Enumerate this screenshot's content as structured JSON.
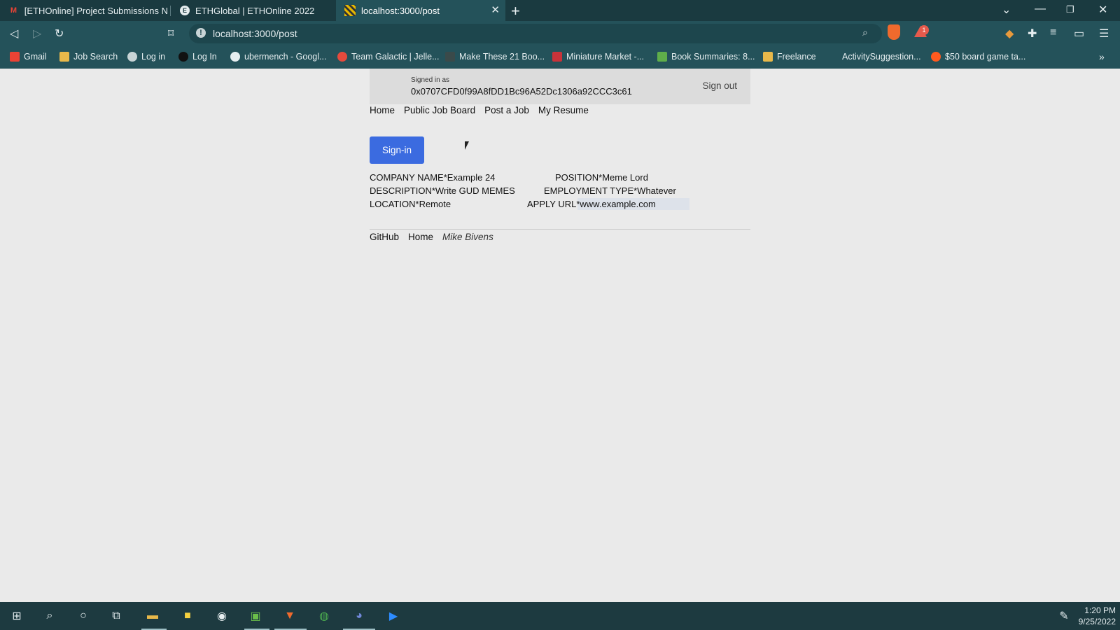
{
  "browser": {
    "tabs": [
      {
        "title": "[ETHOnline] Project Submissions Now",
        "favicon": "gmail-icon"
      },
      {
        "title": "ETHGlobal | ETHOnline 2022",
        "favicon": "ethglobal-icon"
      },
      {
        "title": "localhost:3000/post",
        "favicon": "page-icon",
        "active": true
      }
    ],
    "url": "localhost:3000/post",
    "rewards_badge": "1",
    "bookmarks": [
      "Gmail",
      "Job Search",
      "Log in",
      "Log In",
      "ubermench - Googl...",
      "Team Galactic | Jelle...",
      "Make These 21 Boo...",
      "Miniature Market -...",
      "Book Summaries: 8...",
      "Freelance",
      "ActivitySuggestion...",
      "$50 board game ta..."
    ]
  },
  "page": {
    "signed_in_label": "Signed in as",
    "address": "0x0707CFD0f99A8fDD1Bc96A52Dc1306a92CCC3c61",
    "sign_out": "Sign out",
    "nav": [
      "Home",
      "Public Job Board",
      "Post a Job",
      "My Resume"
    ],
    "sign_in_button": "Sign-in",
    "fields": {
      "company": {
        "label": "COMPANY NAME*",
        "value": "Example 24"
      },
      "position": {
        "label": "POSITION*",
        "value": "Meme Lord"
      },
      "description": {
        "label": "DESCRIPTION*",
        "value": "Write GUD MEMES"
      },
      "employment": {
        "label": "EMPLOYMENT TYPE*",
        "value": "Whatever"
      },
      "location": {
        "label": "LOCATION*",
        "value": "Remote"
      },
      "apply_url": {
        "label": "APPLY URL*",
        "value": "www.example.com"
      }
    },
    "footer": {
      "github": "GitHub",
      "home": "Home",
      "author": "Mike Bivens"
    }
  },
  "taskbar": {
    "time": "1:20 PM",
    "date": "9/25/2022"
  },
  "colors": {
    "chrome_dark": "#1a3a40",
    "chrome": "#24525a",
    "page_bg": "#eaeaea",
    "signin_button": "#3b6be0"
  }
}
